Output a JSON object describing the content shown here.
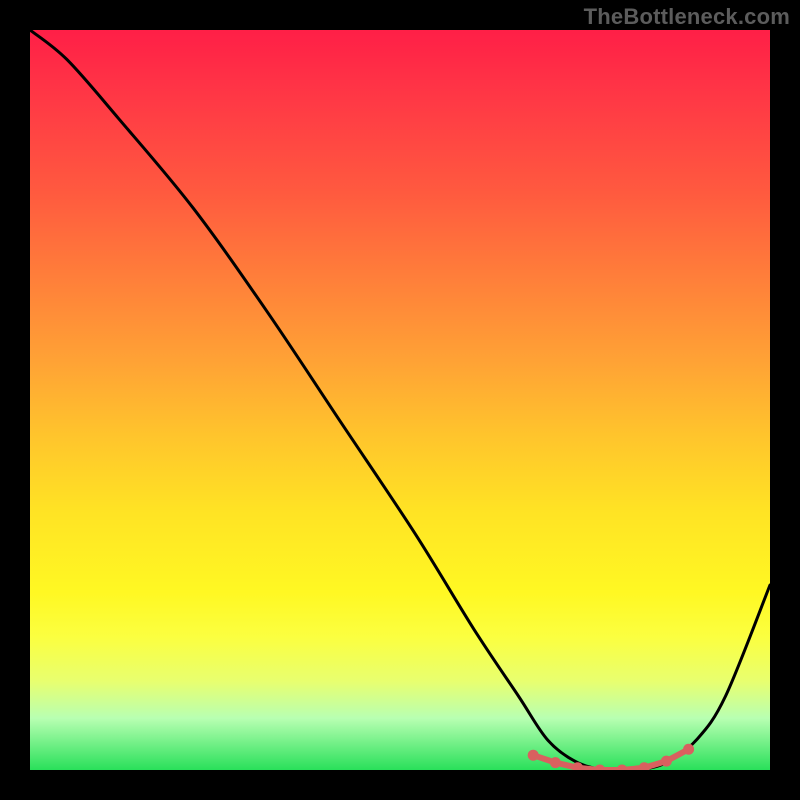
{
  "watermark": "TheBottleneck.com",
  "colors": {
    "page_bg": "#000000",
    "gradient_top": "#ff1f47",
    "gradient_bottom": "#29e05a",
    "curve_stroke": "#000000",
    "dot_fill": "#d9605f",
    "dot_path_stroke": "#d9605f",
    "watermark": "#5c5c5c"
  },
  "chart_data": {
    "type": "line",
    "title": "",
    "xlabel": "",
    "ylabel": "",
    "xlim": [
      0,
      100
    ],
    "ylim": [
      0,
      100
    ],
    "grid": false,
    "legend": false,
    "annotations": [],
    "series": [
      {
        "name": "bottleneck-curve",
        "x": [
          0,
          5,
          12,
          22,
          32,
          42,
          52,
          60,
          66,
          70,
          74,
          78,
          82,
          86,
          90,
          94,
          100
        ],
        "values": [
          100,
          96,
          88,
          76,
          62,
          47,
          32,
          19,
          10,
          4,
          1,
          0,
          0,
          1,
          4,
          10,
          25
        ]
      }
    ],
    "minimum_markers": {
      "name": "optimal-range-dots",
      "x": [
        68,
        71,
        74,
        77,
        80,
        83,
        86,
        89
      ],
      "values": [
        2.0,
        1.0,
        0.3,
        0.0,
        0.0,
        0.3,
        1.2,
        2.8
      ]
    }
  }
}
